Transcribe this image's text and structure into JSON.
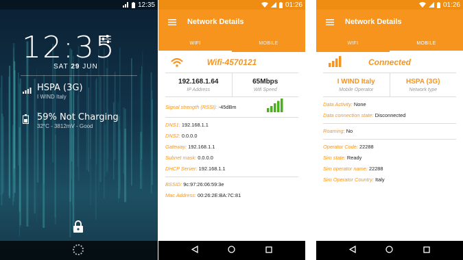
{
  "lock_screen": {
    "status_time": "12:35",
    "clock": "12:35",
    "date_day": "SAT",
    "date_num": "29",
    "date_month": "JUN",
    "network_name": "HSPA (3G)",
    "operator": "I WIND Italy",
    "battery_status": "59% Not Charging",
    "battery_details": "32°C - 3812mV - Good"
  },
  "wifi_panel": {
    "status_time": "01:26",
    "app_title": "Network Details",
    "tabs": [
      "WIFI",
      "MOBILE"
    ],
    "active_tab": "WIFI",
    "ssid": "Wifi-4570121",
    "ip_address": "192.168.1.64",
    "ip_label": "IP Address",
    "wifi_speed": "65Mbps",
    "speed_label": "Wifi Speed",
    "signal_label": "Signal strength (RSSI):",
    "signal_value": "-45dBm",
    "dns_rows": [
      {
        "key": "DNS1:",
        "value": "192.168.1.1"
      },
      {
        "key": "DNS2:",
        "value": "0.0.0.0"
      },
      {
        "key": "Gateway:",
        "value": "192.168.1.1"
      },
      {
        "key": "Subnet mask:",
        "value": "0.0.0.0"
      },
      {
        "key": "DHCP Server:",
        "value": "192.168.1.1"
      }
    ],
    "mac_rows": [
      {
        "key": "BSSID:",
        "value": "9c:97:26:06:59:3e"
      },
      {
        "key": "Mac Address:",
        "value": "00:26:2E:BA:7C:81"
      }
    ]
  },
  "mobile_panel": {
    "status_time": "01:26",
    "app_title": "Network Details",
    "tabs": [
      "WIFI",
      "MOBILE"
    ],
    "active_tab": "MOBILE",
    "connection": "Connected",
    "operator": "I WIND Italy",
    "operator_label": "Mobile Operator",
    "network_type": "HSPA (3G)",
    "network_type_label": "Network type",
    "data_rows": [
      {
        "key": "Data Activity:",
        "value": "None"
      },
      {
        "key": "Data connection state:",
        "value": "Disconnected"
      }
    ],
    "roaming_rows": [
      {
        "key": "Roaming:",
        "value": "No"
      }
    ],
    "sim_rows": [
      {
        "key": "Operator Code:",
        "value": "22288"
      },
      {
        "key": "Sim state:",
        "value": "Ready"
      },
      {
        "key": "Sim operator name:",
        "value": "22288"
      },
      {
        "key": "Sim Operator Country:",
        "value": "Italy"
      }
    ]
  },
  "colors": {
    "accent": "#f7941d",
    "status_bar": "#ef8c12",
    "signal_green": "#4caf1f"
  },
  "icons": [
    "menu-icon",
    "wifi-icon",
    "signal-bars-icon",
    "battery-icon",
    "lock-icon",
    "back-icon",
    "home-icon",
    "recents-icon",
    "sliders-icon"
  ]
}
